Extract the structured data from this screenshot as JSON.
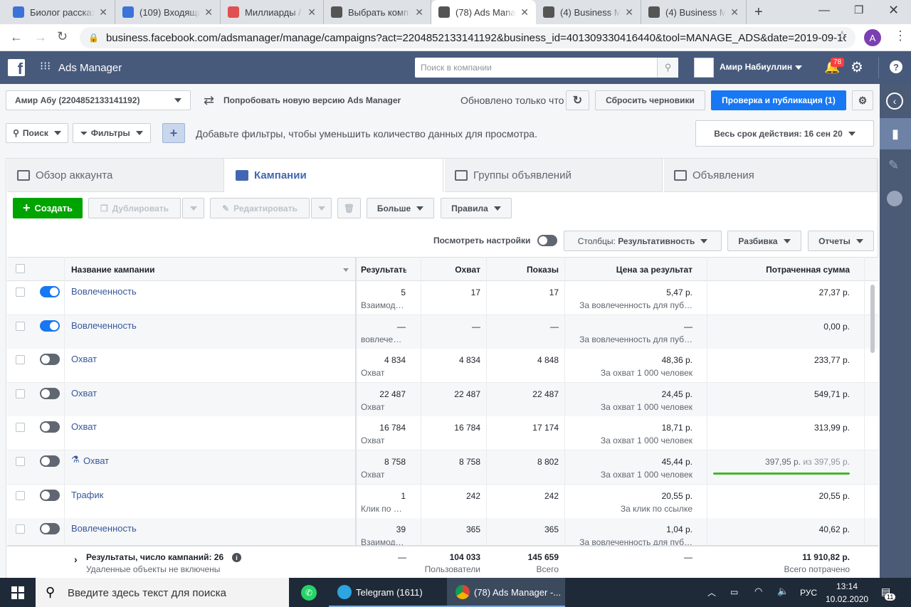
{
  "browser": {
    "tabs": [
      {
        "title": "Биолог рассказ",
        "color": "#3b73d9"
      },
      {
        "title": "(109) Входящие",
        "color": "#3b73d9"
      },
      {
        "title": "Миллиарды / ",
        "color": "#e05050"
      },
      {
        "title": "Выбрать комп",
        "color": "#555"
      },
      {
        "title": "(78) Ads Mana",
        "color": "#555"
      },
      {
        "title": "(4) Business M",
        "color": "#555"
      },
      {
        "title": "(4) Business M",
        "color": "#555"
      }
    ],
    "new_tab": "+",
    "url": "business.facebook.com/adsmanager/manage/campaigns?act=2204852133141192&business_id=401309330416440&tool=MANAGE_ADS&date=2019-09-16...",
    "profile_initial": "A"
  },
  "fb": {
    "app_name": "Ads Manager",
    "search_placeholder": "Поиск в компании",
    "user_name": "Амир Набиуллин",
    "notif_count": "78",
    "help": "?"
  },
  "toolbar": {
    "account": "Амир Абу (2204852133141192)",
    "try_new": "Попробовать новую версию Ads Manager",
    "updated": "Обновлено только что",
    "discard": "Сбросить черновики",
    "publish": "Проверка и публикация (1)"
  },
  "filters": {
    "search": "Поиск",
    "filters": "Фильтры",
    "hint": "Добавьте фильтры, чтобы уменьшить количество данных для просмотра.",
    "date": "Весь срок действия: 16 сен 20"
  },
  "nav_tabs": [
    "Обзор аккаунта",
    "Кампании",
    "Группы объявлений",
    "Объявления"
  ],
  "actions": {
    "create": "Создать",
    "duplicate": "Дублировать",
    "edit": "Редактировать",
    "more": "Больше",
    "rules": "Правила",
    "view_settings": "Посмотреть настройки",
    "columns_label": "Столбцы:",
    "columns_value": "Результативность",
    "breakdown": "Разбивка",
    "reports": "Отчеты"
  },
  "table": {
    "headers": [
      "Название кампании",
      "Результаты",
      "Охват",
      "Показы",
      "Цена за результат",
      "Потраченная сумма"
    ],
    "rows": [
      {
        "on": true,
        "name": "Вовлеченность",
        "res": "5",
        "res_sub": "Взаимод…",
        "reach": "17",
        "impr": "17",
        "cpr": "5,47 р.",
        "cpr_sub": "За вовлеченность для пуб…",
        "spent": "27,37 р.",
        "spent_sub": ""
      },
      {
        "on": true,
        "name": "Вовлеченность",
        "res": "—",
        "res_sub": "вовлече…",
        "reach": "—",
        "impr": "—",
        "cpr": "—",
        "cpr_sub": "За вовлеченность для пуб…",
        "spent": "0,00 р.",
        "spent_sub": ""
      },
      {
        "on": false,
        "name": "Охват",
        "res": "4 834",
        "res_sub": "Охват",
        "reach": "4 834",
        "impr": "4 848",
        "cpr": "48,36 р.",
        "cpr_sub": "За охват 1 000 человек",
        "spent": "233,77 р.",
        "spent_sub": ""
      },
      {
        "on": false,
        "name": "Охват",
        "res": "22 487",
        "res_sub": "Охват",
        "reach": "22 487",
        "impr": "22 487",
        "cpr": "24,45 р.",
        "cpr_sub": "За охват 1 000 человек",
        "spent": "549,71 р.",
        "spent_sub": ""
      },
      {
        "on": false,
        "name": "Охват",
        "res": "16 784",
        "res_sub": "Охват",
        "reach": "16 784",
        "impr": "17 174",
        "cpr": "18,71 р.",
        "cpr_sub": "За охват 1 000 человек",
        "spent": "313,99 р.",
        "spent_sub": ""
      },
      {
        "on": false,
        "name": "Охват",
        "flask": true,
        "res": "8 758",
        "res_sub": "Охват",
        "reach": "8 758",
        "impr": "8 802",
        "cpr": "45,44 р.",
        "cpr_sub": "За охват 1 000 человек",
        "spent": "397,95 р.",
        "spent_sub": "из 397,95 р."
      },
      {
        "on": false,
        "name": "Трафик",
        "res": "1",
        "res_sub": "Клик по …",
        "reach": "242",
        "impr": "242",
        "cpr": "20,55 р.",
        "cpr_sub": "За клик по ссылке",
        "spent": "20,55 р.",
        "spent_sub": ""
      },
      {
        "on": false,
        "name": "Вовлеченность",
        "res": "39",
        "res_sub": "Взаимод…",
        "reach": "365",
        "impr": "365",
        "cpr": "1,04 р.",
        "cpr_sub": "За вовлеченность для пуб…",
        "spent": "40,62 р.",
        "spent_sub": ""
      }
    ],
    "footer": {
      "title": "Результаты, число кампаний: 26",
      "sub": "Удаленные объекты не включены",
      "res": "—",
      "reach": "104 033",
      "reach_sub": "Пользователи",
      "impr": "145 659",
      "impr_sub": "Всего",
      "cpr": "—",
      "spent": "11 910,82 р.",
      "spent_sub": "Всего потрачено"
    }
  },
  "taskbar": {
    "search": "Введите здесь текст для поиска",
    "telegram": "Telegram (1611)",
    "chrome": "(78) Ads Manager -...",
    "lang": "РУС",
    "time": "13:14",
    "date": "10.02.2020",
    "notif": "11"
  },
  "colors": {
    "fb_header": "#475a7c",
    "primary": "#1877f2",
    "green": "#00a400",
    "link": "#365899"
  }
}
